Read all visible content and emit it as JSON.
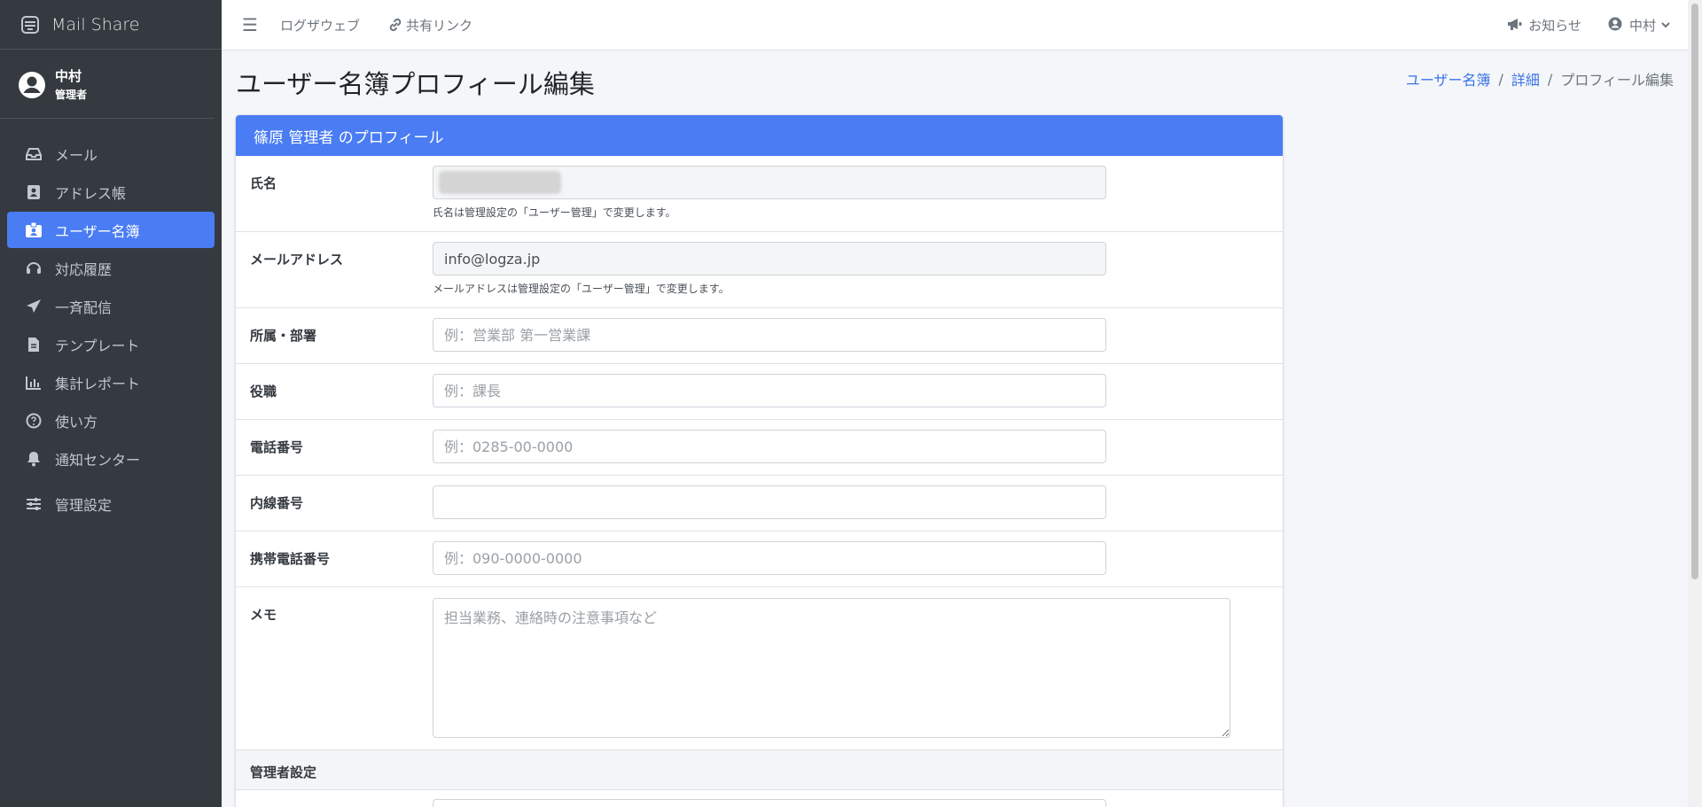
{
  "app": {
    "name": "Mail Share"
  },
  "user": {
    "name": "中村",
    "role": "管理者"
  },
  "sidebar": {
    "items": [
      {
        "label": "メール",
        "icon": "inbox-icon"
      },
      {
        "label": "アドレス帳",
        "icon": "address-book-icon"
      },
      {
        "label": "ユーザー名簿",
        "icon": "id-badge-icon",
        "active": true
      },
      {
        "label": "対応履歴",
        "icon": "headset-icon"
      },
      {
        "label": "一斉配信",
        "icon": "paper-plane-icon"
      },
      {
        "label": "テンプレート",
        "icon": "file-icon"
      },
      {
        "label": "集計レポート",
        "icon": "bar-chart-icon"
      },
      {
        "label": "使い方",
        "icon": "question-circle-icon"
      },
      {
        "label": "通知センター",
        "icon": "bell-icon"
      },
      {
        "label": "管理設定",
        "icon": "sliders-icon"
      }
    ]
  },
  "topbar": {
    "links": [
      {
        "label": "ログザウェブ"
      },
      {
        "label": "共有リンク",
        "icon": "link-icon"
      }
    ],
    "notifications_label": "お知らせ",
    "user_menu_label": "中村"
  },
  "page": {
    "title": "ユーザー名簿プロフィール編集",
    "breadcrumb": [
      "ユーザー名簿",
      "詳細",
      "プロフィール編集"
    ]
  },
  "card": {
    "header": "篠原 管理者 のプロフィール",
    "fields": {
      "name": {
        "label": "氏名",
        "help": "氏名は管理設定の「ユーザー管理」で変更します。"
      },
      "email": {
        "label": "メールアドレス",
        "value": "info@logza.jp",
        "help": "メールアドレスは管理設定の「ユーザー管理」で変更します。"
      },
      "dept": {
        "label": "所属・部署",
        "placeholder": "例：営業部 第一営業課"
      },
      "position": {
        "label": "役職",
        "placeholder": "例：課長"
      },
      "phone": {
        "label": "電話番号",
        "placeholder": "例：0285-00-0000"
      },
      "extension": {
        "label": "内線番号",
        "placeholder": ""
      },
      "mobile": {
        "label": "携帯電話番号",
        "placeholder": "例：090-0000-0000"
      },
      "memo": {
        "label": "メモ",
        "placeholder": "担当業務、連絡時の注意事項など"
      }
    },
    "admin_section_label": "管理者設定"
  },
  "colors": {
    "accent": "#4a7cf4",
    "sidebar_bg": "#343a40",
    "link": "#3b73e8"
  }
}
